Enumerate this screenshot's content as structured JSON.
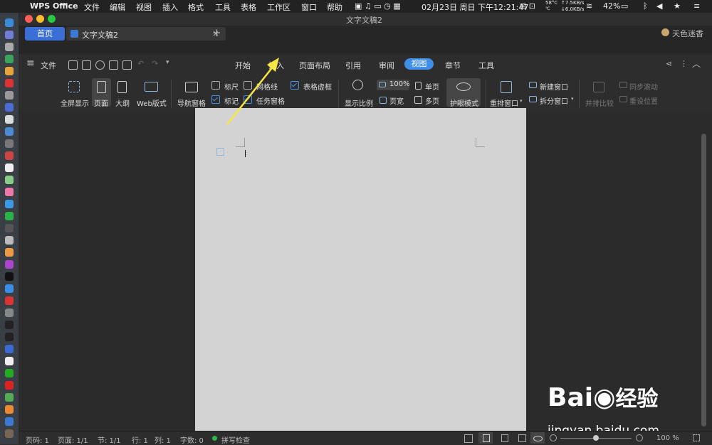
{
  "mac_menubar": {
    "app_name": "WPS Office",
    "items": [
      "文件",
      "编辑",
      "视图",
      "插入",
      "格式",
      "工具",
      "表格",
      "工作区",
      "窗口",
      "帮助"
    ],
    "temp": "58°C",
    "net_up": "↑7.5KB/s",
    "net_down": "↓6.0KB/s",
    "datetime": "02月23日 周日 下午12:21:47",
    "battery": "42%"
  },
  "window": {
    "title": "文字文稿2"
  },
  "tabs": {
    "home_label": "首页",
    "doc_tab_label": "文字文稿2",
    "add_label": "+",
    "user_name": "天色迷香"
  },
  "toolbar": {
    "file_label": "文件",
    "ribbon_tabs": [
      "开始",
      "插入",
      "页面布局",
      "引用",
      "审阅",
      "视图",
      "章节",
      "工具"
    ],
    "active_tab": "视图"
  },
  "ribbon": {
    "fullscreen": "全屏显示",
    "page": "页面",
    "outline": "大纲",
    "web_layout": "Web版式",
    "nav_pane": "导航窗格",
    "ruler": "标尺",
    "gridlines": "网格线",
    "table_grid": "表格虚框",
    "mark": "标记",
    "task_pane": "任务窗格",
    "zoom_ratio": "显示比例",
    "zoom_100": "100%",
    "page_width": "页宽",
    "single_page": "单页",
    "multi_page": "多页",
    "eye_mode": "护眼模式",
    "rearrange": "重排窗口",
    "new_window": "新建窗口",
    "split_window": "拆分窗口",
    "side_by_side": "并排比较",
    "sync_scroll": "同步滚动",
    "reset_pos": "重设位置"
  },
  "statusbar": {
    "page_code": "页码: 1",
    "page": "页面: 1/1",
    "section": "节: 1/1",
    "row": "行: 1",
    "col": "列: 1",
    "word_count": "字数: 0",
    "spell_check": "拼写检查",
    "zoom": "100 %"
  },
  "watermark": {
    "brand": "Bai",
    "brand_cn": "经验",
    "url": "jingyan.baidu.com"
  },
  "colors": {
    "accent": "#4a90e2",
    "arrow": "#f5e642"
  }
}
